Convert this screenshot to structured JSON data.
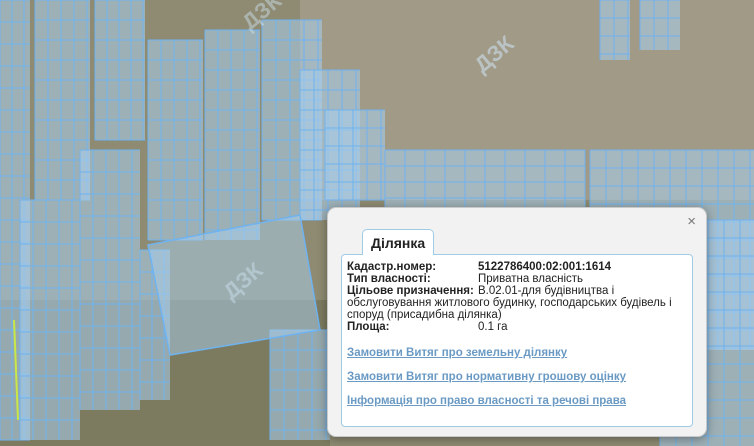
{
  "map": {
    "watermark": "ДЗК"
  },
  "popup": {
    "tab_title": "Ділянка",
    "close_symbol": "×",
    "fields": {
      "cadastral_label": "Кадастр.номер:",
      "cadastral_value": "5122786400:02:001:1614",
      "ownership_label": "Тип власності:",
      "ownership_value": "Приватна власність",
      "purpose_label": "Цільове призначення:",
      "purpose_value_line1": "В.02.01-для будівництва і",
      "purpose_value_rest": "обслуговування житлового будинку, господарських будівель і споруд (присадибна ділянка)",
      "area_label": "Площа:",
      "area_value": "0.1 га"
    },
    "links": [
      "Замовити Витяг про земельну ділянку",
      "Замовити Витяг про нормативну грошову оцінку",
      "Інформація про право власності та речові права"
    ]
  },
  "colors": {
    "parcel_fill": "#a9cfee",
    "parcel_stroke": "#6fb3f0",
    "link": "#6a9ac4"
  }
}
